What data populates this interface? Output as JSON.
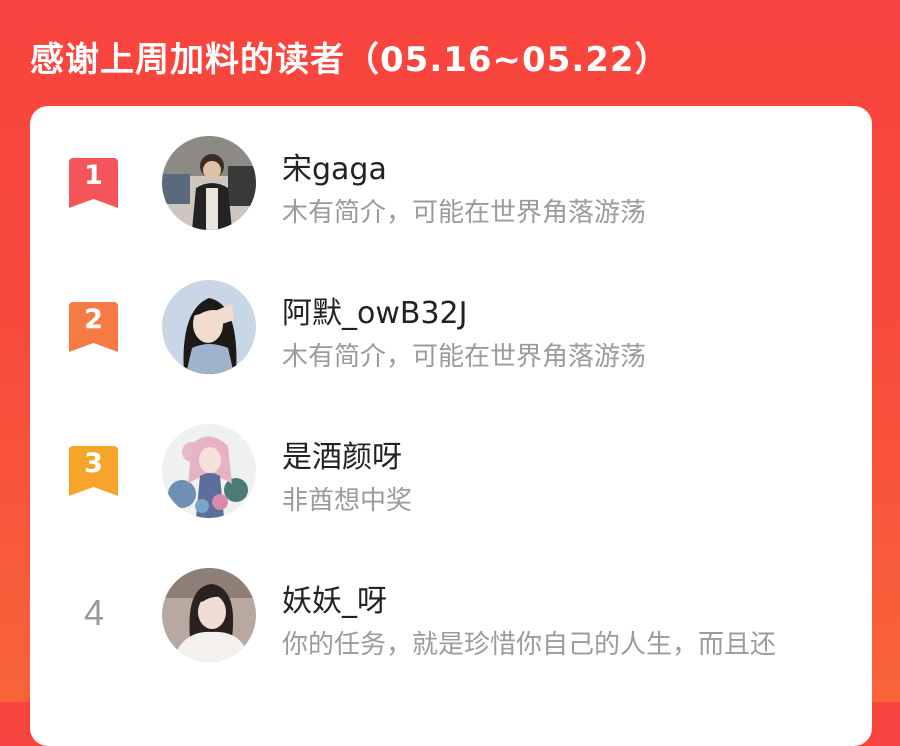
{
  "header": {
    "title": "感谢上周加料的读者（05.16~05.22）"
  },
  "colors": {
    "background_top": "#f8443f",
    "background_bottom": "#f8643a",
    "rank1": "#f5545a",
    "rank2": "#f77a45",
    "rank3": "#f7a42a",
    "name_text": "#222222",
    "desc_text": "#9b9b9b"
  },
  "readers": [
    {
      "rank": "1",
      "name": "宋gaga",
      "desc": "木有简介，可能在世界角落游荡",
      "avatar": "avatar-photo-person"
    },
    {
      "rank": "2",
      "name": "阿默_owB32J",
      "desc": "木有简介，可能在世界角落游荡",
      "avatar": "avatar-photo-girl"
    },
    {
      "rank": "3",
      "name": "是酒颜呀",
      "desc": "非酋想中奖",
      "avatar": "avatar-anime-illustration"
    },
    {
      "rank": "4",
      "name": "妖妖_呀",
      "desc": "你的任务，就是珍惜你自己的人生，而且还",
      "avatar": "avatar-photo-woman"
    }
  ]
}
